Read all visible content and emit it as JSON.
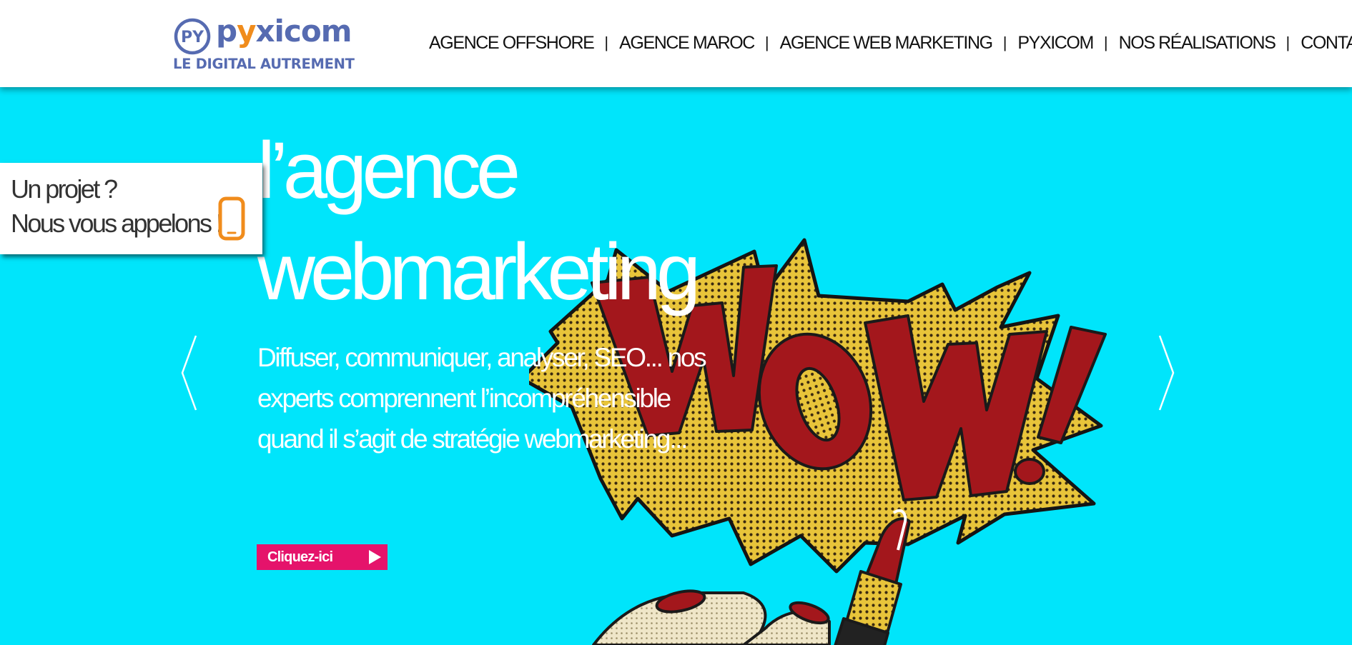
{
  "header": {
    "logo": {
      "wordmark_part1": "p",
      "wordmark_y": "y",
      "wordmark_part2": "xicom",
      "badge_text": "PY",
      "tagline": "LE DIGITAL AUTREMENT"
    },
    "nav": [
      {
        "label": "AGENCE OFFSHORE"
      },
      {
        "label": "AGENCE MAROC"
      },
      {
        "label": "AGENCE WEB MARKETING"
      },
      {
        "label": "PYXICOM"
      },
      {
        "label": "NOS RÉALISATIONS"
      },
      {
        "label": "CONTACT"
      }
    ],
    "separator": "|"
  },
  "callback": {
    "line1": "Un projet ?",
    "line2": "Nous vous appelons !",
    "icon": "smartphone-icon"
  },
  "hero": {
    "title_line1": "l’agence",
    "title_line2": "webmarketing",
    "description": "Diffuser, communiquer, analyser, SEO... nos experts comprennent l’incompréhensible quand il s’agit de stratégie webmarketing...",
    "cta_label": "Cliquez-ici",
    "illustration_text": "WOW!"
  },
  "colors": {
    "background": "#00e5fb",
    "brand_blue": "#566bb1",
    "brand_orange": "#f08c1c",
    "cta_pink": "#e5136b",
    "wow_red": "#a3171c",
    "burst_yellow": "#e8c43a"
  }
}
